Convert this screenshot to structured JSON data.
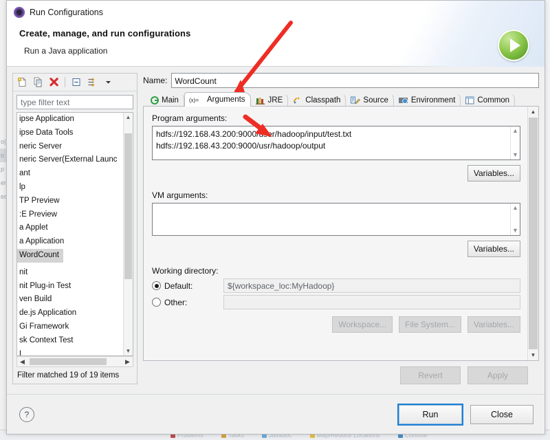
{
  "window": {
    "title": "Run Configurations",
    "title_icon": "eclipse-run-config-icon",
    "close_icon": "close-icon"
  },
  "header": {
    "title": "Create, manage, and run configurations",
    "subtitle": "Run a Java application",
    "badge_icon": "green-run-play-icon"
  },
  "left_panel": {
    "toolbar": [
      {
        "name": "new-configuration-icon",
        "label": "New launch configuration"
      },
      {
        "name": "duplicate-configuration-icon",
        "label": "Duplicate"
      },
      {
        "name": "delete-configuration-icon",
        "label": "Delete"
      },
      {
        "name": "collapse-all-icon",
        "label": "Collapse All"
      },
      {
        "name": "filter-icon",
        "label": "Filter"
      },
      {
        "name": "chevron-down-icon",
        "label": "View Menu"
      }
    ],
    "filter_placeholder": "type filter text",
    "filter_value": "",
    "items": [
      {
        "label": "ipse Application",
        "selected": false
      },
      {
        "label": "ipse Data Tools",
        "selected": false
      },
      {
        "label": "neric Server",
        "selected": false
      },
      {
        "label": "neric Server(External Launc",
        "selected": false
      },
      {
        "label": "ant",
        "selected": false
      },
      {
        "label": "lp",
        "selected": false
      },
      {
        "label": "TP Preview",
        "selected": false
      },
      {
        "label": ":E Preview",
        "selected": false
      },
      {
        "label": "a Applet",
        "selected": false
      },
      {
        "label": "a Application",
        "selected": false
      },
      {
        "label": "WordCount",
        "selected": true
      },
      {
        "label": "nit",
        "selected": false
      },
      {
        "label": "nit Plug-in Test",
        "selected": false
      },
      {
        "label": "ven Build",
        "selected": false
      },
      {
        "label": "de.js Application",
        "selected": false
      },
      {
        "label": "Gi Framework",
        "selected": false
      },
      {
        "label": "sk Context Test",
        "selected": false
      },
      {
        "label": "L",
        "selected": false
      }
    ],
    "status": "Filter matched 19 of 19 items",
    "scroll_up_icon": "chevron-up-icon",
    "scroll_down_icon": "chevron-down-icon",
    "hscroll_left_icon": "chevron-left-icon",
    "hscroll_right_icon": "chevron-right-icon"
  },
  "main": {
    "name_label": "Name:",
    "name_value": "WordCount",
    "tabs": [
      {
        "label": "Main",
        "icon": "main-green-circle-icon",
        "active": false
      },
      {
        "label": "Arguments",
        "icon": "arguments-variable-icon",
        "active": true
      },
      {
        "label": "JRE",
        "icon": "jre-books-icon",
        "active": false
      },
      {
        "label": "Classpath",
        "icon": "classpath-folders-icon",
        "active": false
      },
      {
        "label": "Source",
        "icon": "source-pencil-icon",
        "active": false
      },
      {
        "label": "Environment",
        "icon": "environment-globe-icon",
        "active": false
      },
      {
        "label": "Common",
        "icon": "common-window-icon",
        "active": false
      }
    ],
    "program_arguments": {
      "label": "Program arguments:",
      "lines": [
        "hdfs://192.168.43.200:9000/user/hadoop/input/test.txt",
        "hdfs://192.168.43.200:9000/usr/hadoop/output"
      ],
      "variables_button": "Variables..."
    },
    "vm_arguments": {
      "label": "VM arguments:",
      "lines": [],
      "value": "",
      "variables_button": "Variables..."
    },
    "working_directory": {
      "label": "Working directory:",
      "default_label": "Default:",
      "default_selected": true,
      "default_value": "${workspace_loc:MyHadoop}",
      "other_label": "Other:",
      "other_selected": false,
      "other_value": "",
      "buttons": [
        {
          "label": "Workspace...",
          "enabled": false
        },
        {
          "label": "File System...",
          "enabled": false
        },
        {
          "label": "Variables...",
          "enabled": false
        }
      ]
    },
    "revert_button": {
      "label": "Revert",
      "enabled": false
    },
    "apply_button": {
      "label": "Apply",
      "enabled": false
    }
  },
  "footer": {
    "help_icon": "help-question-icon",
    "run_button": "Run",
    "close_button": "Close"
  },
  "annotations": [
    {
      "name": "arrow-to-name-tab-area",
      "color": "#ee2d24"
    },
    {
      "name": "arrow-to-program-arguments",
      "color": "#ee2d24"
    }
  ],
  "background": {
    "left_items": [
      "o|",
      "o",
      "p",
      "en",
      "ed"
    ],
    "tabs": [
      {
        "label": "Problems",
        "color": "#c0504d"
      },
      {
        "label": "Tasks",
        "color": "#d9a441"
      },
      {
        "label": "Javadoc",
        "color": "#6faed9"
      },
      {
        "label": "Map/Reduce Locations",
        "color": "#e2c044"
      },
      {
        "label": "Console",
        "color": "#4a90c4"
      }
    ]
  },
  "colors": {
    "accent": "#1f7fd4",
    "annotation": "#ee2d24",
    "run_green": "#7cc038",
    "dialog_bg": "#f0f0f0",
    "selection": "#d4d4d4"
  }
}
